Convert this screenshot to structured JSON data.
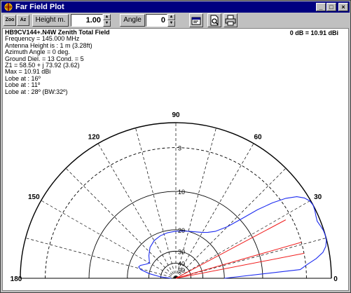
{
  "window": {
    "title": "Far Field Plot"
  },
  "toolbar": {
    "zoom_label": "Zoo",
    "az_label": "Az",
    "height_label": "Height m.",
    "height_value": "1.00",
    "angle_label": "Angle",
    "angle_value": "0"
  },
  "info": {
    "heading": "HB9CV144+.N4W Zenith Total Field",
    "frequency": "Frequency = 145.000 MHz",
    "antenna_height": "Antenna Height is : 1 m (3.28ft)",
    "azimuth": "Azimuth Angle = 0 deg.",
    "ground": "Ground Diel. = 13 Cond. = 5",
    "impedance": "Z1 = 58.50 + j 73.92 (3.62)",
    "max": "Max = 10.91 dBi",
    "lobe1": "Lobe at : 16º",
    "lobe2": "Lobe at : 11º",
    "lobe3": "Lobe at : 28º (BW:32º)",
    "db_reference": "0 dB = 10.91 dBi"
  },
  "chart_data": {
    "type": "polar",
    "title": "HB9CV144+.N4W Zenith Total Field",
    "angle_labels": [
      "0",
      "30",
      "60",
      "90",
      "120",
      "150",
      "180"
    ],
    "ring_labels": [
      "3",
      "10",
      "20",
      "30",
      "40",
      "50"
    ],
    "series": [
      {
        "name": "Total Field",
        "points": [
          [
            0,
            20
          ],
          [
            4,
            3.8
          ],
          [
            6,
            2.8
          ],
          [
            8,
            1.6
          ],
          [
            10,
            0.7
          ],
          [
            12,
            0.25
          ],
          [
            14,
            0.05
          ],
          [
            16,
            0
          ],
          [
            18,
            0.05
          ],
          [
            20,
            0.2
          ],
          [
            22,
            0.35
          ],
          [
            24,
            0.25
          ],
          [
            26,
            0.1
          ],
          [
            28,
            0
          ],
          [
            30,
            0.1
          ],
          [
            32,
            0.45
          ],
          [
            34,
            1.1
          ],
          [
            36,
            2.3
          ],
          [
            38,
            4.1
          ],
          [
            40,
            6.5
          ],
          [
            42,
            9.5
          ],
          [
            45,
            13
          ],
          [
            50,
            16
          ],
          [
            55,
            17.5
          ],
          [
            60,
            18.5
          ],
          [
            70,
            19.6
          ],
          [
            80,
            20.2
          ],
          [
            90,
            20.5
          ],
          [
            100,
            20.8
          ],
          [
            110,
            21.2
          ],
          [
            120,
            21.9
          ],
          [
            130,
            23.2
          ],
          [
            140,
            25.5
          ],
          [
            150,
            28
          ],
          [
            155,
            26.5
          ],
          [
            160,
            24.3
          ],
          [
            163,
            23.8
          ],
          [
            166,
            25
          ],
          [
            170,
            30
          ],
          [
            175,
            40
          ],
          [
            180,
            60
          ]
        ]
      }
    ],
    "lobe_angles_deg": [
      16,
      11,
      28
    ]
  }
}
